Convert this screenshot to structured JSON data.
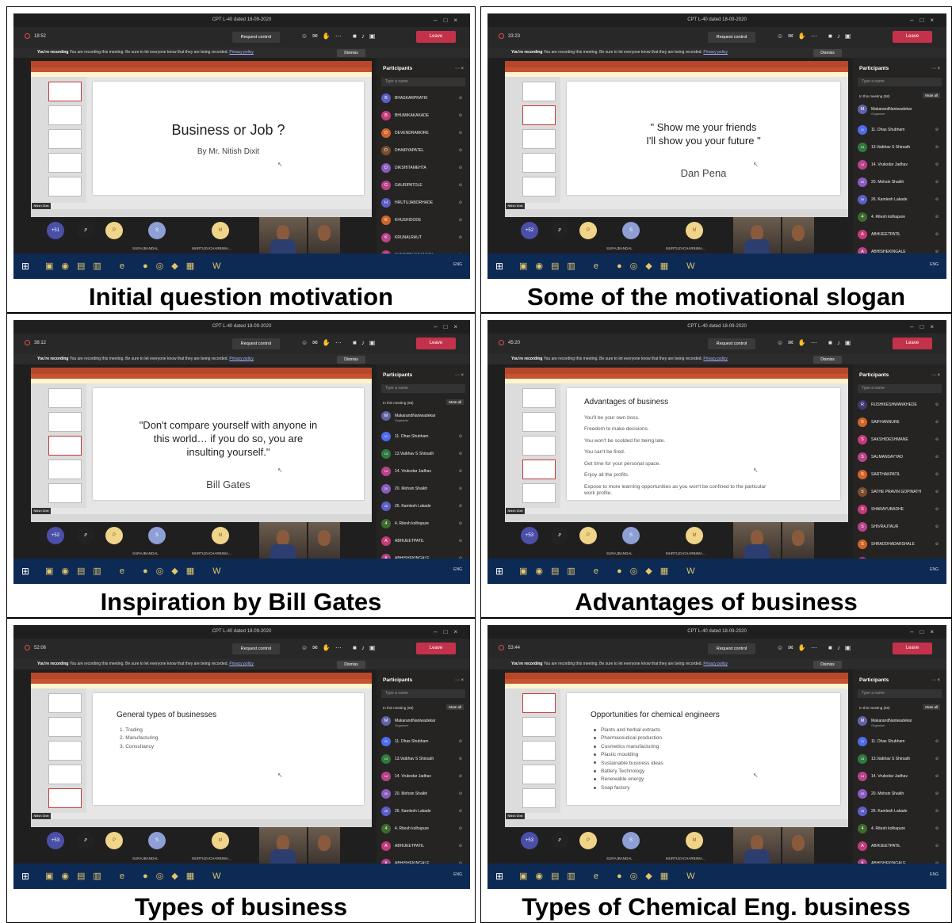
{
  "app": {
    "window_title": "CPT L-40 dated 18-09-2020",
    "request_control": "Request control",
    "leave_label": "Leave",
    "banner_bold": "You're recording",
    "banner_text": "You are recording this meeting. Be sure to let everyone know that they are being recorded.",
    "banner_link": "Privacy policy",
    "dismiss_label": "Dismiss",
    "participants_header": "Participants",
    "search_placeholder": "Type a name",
    "in_meeting_label": "In this meeting (58)",
    "mute_all_label": "Mute all",
    "organizer_label": "Organizer",
    "presenter_tag": "Nitish Dixit",
    "strip_name_1": "SURAJBANDAL",
    "strip_name_2": "MURTUZACHARBIWA...",
    "taskbar_lang": "ENG"
  },
  "panels": [
    {
      "caption": "Initial question motivation",
      "timer": "18:52",
      "slide": {
        "title": "Business or Job ?",
        "subtitle": "By Mr. Nitish Dixit"
      },
      "strip_badge": "+51",
      "participants": [
        {
          "initial": "B",
          "name": "BHASKARPRATIK",
          "color": "#5b5fc7"
        },
        {
          "initial": "B",
          "name": "BHUMIKAKAKADE",
          "color": "#c43b7a"
        },
        {
          "initial": "D",
          "name": "DEVENDRAMORE",
          "color": "#d06428"
        },
        {
          "initial": "D",
          "name": "DHAIRYAPATEL",
          "color": "#7a4d2c"
        },
        {
          "initial": "D",
          "name": "DIKSHITAMEHTA",
          "color": "#8a5cc0"
        },
        {
          "initial": "G",
          "name": "GAURIPATOLE",
          "color": "#b9428a"
        },
        {
          "initial": "H",
          "name": "HRUTUJABORHADE",
          "color": "#5b5fc7"
        },
        {
          "initial": "K",
          "name": "KHUSHIDODE",
          "color": "#d06428"
        },
        {
          "initial": "K",
          "name": "KRUNALRAUT",
          "color": "#b9428a"
        },
        {
          "initial": "K",
          "name": "KUMARDHANANJAY",
          "color": "#c43b7a"
        }
      ]
    },
    {
      "caption": "Some of the motivational slogan",
      "timer": "33:23",
      "slide": {
        "title": "\" Show me your friends\nI'll show you your future \"",
        "subtitle": "Dan Pena"
      },
      "strip_badge": "+52",
      "participants": [
        {
          "initial": "M",
          "name": "MakarandNaniwadekar",
          "color": "#6264a7",
          "org": true
        },
        {
          "initial": "11",
          "name": "11. Dhas Shubham",
          "color": "#4f6bed"
        },
        {
          "initial": "13",
          "name": "13.Vaibhav S Shirsath",
          "color": "#2f7a3c"
        },
        {
          "initial": "14",
          "name": "14. Vrukodar Jadhav",
          "color": "#b9428a"
        },
        {
          "initial": "20",
          "name": "20. Mohsin Shaikh",
          "color": "#8a5cc0"
        },
        {
          "initial": "26",
          "name": "26. Kamlesh Lakade",
          "color": "#5b5fc7"
        },
        {
          "initial": "4",
          "name": "4. Ritesh kolhapure",
          "color": "#3c6b2c"
        },
        {
          "initial": "A",
          "name": "ABHIJEETPATIL",
          "color": "#c43b7a"
        },
        {
          "initial": "A",
          "name": "ABHISHEKINGALE",
          "color": "#b9428a"
        }
      ]
    },
    {
      "caption": "Inspiration by Bill Gates",
      "timer": "38:12",
      "slide": {
        "title": "\"Don't compare yourself with anyone in\nthis world… if you do so, you are\ninsulting yourself.\"",
        "subtitle": "Bill Gates"
      },
      "strip_badge": "+52",
      "participants": [
        {
          "initial": "M",
          "name": "MakarandNaniwadekar",
          "color": "#6264a7",
          "org": true
        },
        {
          "initial": "11",
          "name": "11. Dhas Shubham",
          "color": "#4f6bed"
        },
        {
          "initial": "13",
          "name": "13.Vaibhav S Shirsath",
          "color": "#2f7a3c"
        },
        {
          "initial": "14",
          "name": "14. Vrukodar Jadhav",
          "color": "#b9428a"
        },
        {
          "initial": "20",
          "name": "20. Mohsin Shaikh",
          "color": "#8a5cc0"
        },
        {
          "initial": "26",
          "name": "26. Kamlesh Lakade",
          "color": "#5b5fc7"
        },
        {
          "initial": "4",
          "name": "4. Ritesh kolhapure",
          "color": "#3c6b2c"
        },
        {
          "initial": "A",
          "name": "ABHIJEETPATIL",
          "color": "#c43b7a"
        },
        {
          "initial": "A",
          "name": "ABHISHEKINGALE",
          "color": "#b9428a"
        }
      ]
    },
    {
      "caption": "Advantages of business",
      "timer": "45:20",
      "slide": {
        "heading": "Advantages of business",
        "items": [
          "You'll be your own boss.",
          "Freedom to make decisions.",
          "You won't be scolded for being late.",
          "You can't be fired.",
          "Get time for your personal space.",
          "Enjoy all the profits.",
          "Expose to more learning opportunities as you won't be confined to the particular\nwork profile."
        ]
      },
      "strip_badge": "+53",
      "participants": [
        {
          "initial": "R",
          "name": "RUSHIKESHWANKHEDE",
          "color": "#3e3a6e"
        },
        {
          "initial": "S",
          "name": "SAIFHANNURE",
          "color": "#d06428"
        },
        {
          "initial": "S",
          "name": "SAKSHIDESHMANE",
          "color": "#c43b7a"
        },
        {
          "initial": "S",
          "name": "SALMANSAYYAD",
          "color": "#b9428a"
        },
        {
          "initial": "S",
          "name": "SARTHAKPATIL",
          "color": "#d06428"
        },
        {
          "initial": "S",
          "name": "SATHE PRAVIN GOPINATH",
          "color": "#7a4d2c"
        },
        {
          "initial": "S",
          "name": "SHARAYUBADHE",
          "color": "#c43b7a"
        },
        {
          "initial": "S",
          "name": "SHIVRAJTAUR",
          "color": "#b9428a"
        },
        {
          "initial": "S",
          "name": "SHRADDHADARSHALE",
          "color": "#d06428"
        },
        {
          "initial": "S",
          "name": "SIDDHIPEDAMKAR",
          "color": "#c43b7a"
        }
      ]
    },
    {
      "caption": "Types of business",
      "timer": "52:06",
      "slide": {
        "heading": "General types of businesses",
        "items": [
          "1.  Trading",
          "2.  Manufacturing",
          "3.  Consultancy"
        ]
      },
      "strip_badge": "+53",
      "participants": [
        {
          "initial": "M",
          "name": "MakarandNaniwadekar",
          "color": "#6264a7",
          "org": true
        },
        {
          "initial": "11",
          "name": "11. Dhas Shubham",
          "color": "#4f6bed"
        },
        {
          "initial": "13",
          "name": "13.Vaibhav S Shirsath",
          "color": "#2f7a3c"
        },
        {
          "initial": "14",
          "name": "14. Vrukodar Jadhav",
          "color": "#b9428a"
        },
        {
          "initial": "20",
          "name": "20. Mohsin Shaikh",
          "color": "#8a5cc0"
        },
        {
          "initial": "26",
          "name": "26. Kamlesh Lakade",
          "color": "#5b5fc7"
        },
        {
          "initial": "4",
          "name": "4. Ritesh kolhapure",
          "color": "#3c6b2c"
        },
        {
          "initial": "A",
          "name": "ABHIJEETPATIL",
          "color": "#c43b7a"
        },
        {
          "initial": "A",
          "name": "ABHISHEKINGALE",
          "color": "#b9428a"
        }
      ]
    },
    {
      "caption": "Types of Chemical Eng. business",
      "timer": "53:44",
      "slide": {
        "heading": "Opportunities for chemical engineers",
        "items": [
          "Plants and herbal extracts",
          "Pharmaceutical production",
          "Cosmetics manufacturing",
          "Plastic moulding",
          "Sustainable business ideas",
          "Battery Technology",
          "Renewable energy",
          "Soap factory"
        ]
      },
      "strip_badge": "+53",
      "participants": [
        {
          "initial": "M",
          "name": "MakarandNaniwadekar",
          "color": "#6264a7",
          "org": true
        },
        {
          "initial": "11",
          "name": "11. Dhas Shubham",
          "color": "#4f6bed"
        },
        {
          "initial": "13",
          "name": "13.Vaibhav S Shirsath",
          "color": "#2f7a3c"
        },
        {
          "initial": "14",
          "name": "14. Vrukodar Jadhav",
          "color": "#b9428a"
        },
        {
          "initial": "20",
          "name": "20. Mohsin Shaikh",
          "color": "#8a5cc0"
        },
        {
          "initial": "26",
          "name": "26. Kamlesh Lakade",
          "color": "#5b5fc7"
        },
        {
          "initial": "4",
          "name": "4. Ritesh kolhapure",
          "color": "#3c6b2c"
        },
        {
          "initial": "A",
          "name": "ABHIJEETPATIL",
          "color": "#c43b7a"
        },
        {
          "initial": "A",
          "name": "ABHISHEKINGALE",
          "color": "#b9428a"
        }
      ]
    }
  ]
}
